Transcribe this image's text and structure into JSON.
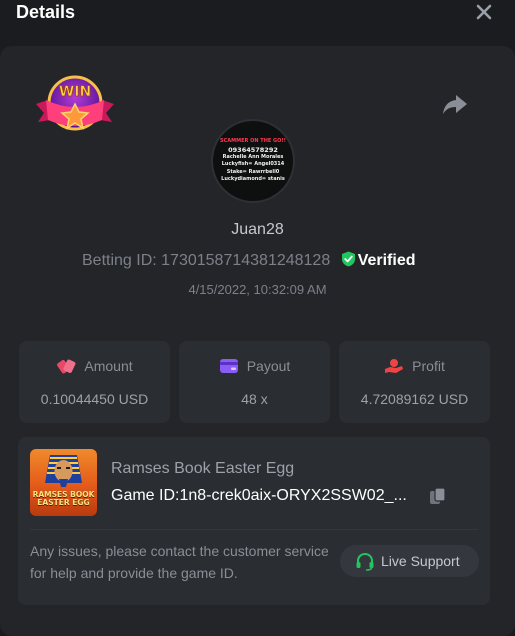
{
  "header": {
    "title": "Details"
  },
  "icons": {
    "close": "close-icon",
    "share": "share-icon",
    "badge": "win-badge-icon",
    "verified": "shield-check-icon",
    "amount": "bet-chip-icon",
    "payout": "wallet-card-icon",
    "profit": "money-hand-icon",
    "copy": "copy-icon",
    "support": "headset-icon"
  },
  "colors": {
    "accent_green": "#22c55e",
    "amount_icon": "#e8496a",
    "payout_icon": "#8b5cf6",
    "profit_icon": "#ef4444"
  },
  "badge": {
    "text": "WIN"
  },
  "avatar": {
    "lines": [
      "SCAMMER ON THE GO!!",
      "09364578292",
      "Rachelle Ann Morales",
      "Luckyfish= Angel0314",
      "Stake= Rawrrbell0",
      "Luckydiamond= stanis"
    ]
  },
  "user": {
    "name": "Juan28",
    "betting_id_label": "Betting ID:",
    "betting_id": "1730158714381248128",
    "verified_label": "Verified",
    "timestamp": "4/15/2022, 10:32:09 AM"
  },
  "stats": [
    {
      "label": "Amount",
      "value": "0.10044450 USD"
    },
    {
      "label": "Payout",
      "value": "48 x"
    },
    {
      "label": "Profit",
      "value": "4.72089162 USD"
    }
  ],
  "game": {
    "thumb_title": "RAMSES BOOK\nEASTER EGG",
    "name": "Ramses Book Easter Egg",
    "id_label": "Game ID:",
    "id_value": "1n8-crek0aix-ORYX2SSW02_..."
  },
  "support": {
    "message": "Any issues, please contact the customer service for help and provide the game ID.",
    "button_label": "Live Support"
  }
}
